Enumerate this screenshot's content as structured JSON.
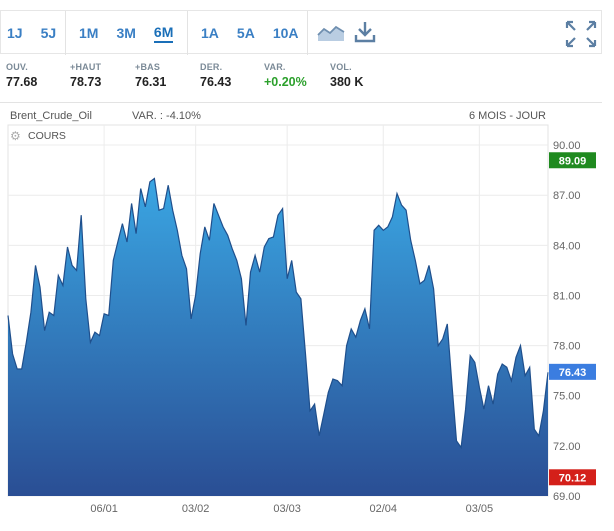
{
  "toolbar": {
    "periods_short": [
      "1J",
      "5J"
    ],
    "periods_mid": [
      "1M",
      "3M",
      "6M"
    ],
    "periods_long": [
      "1A",
      "5A",
      "10A"
    ],
    "active_period": "6M",
    "icons": [
      "line-chart-icon",
      "download-icon",
      "fullscreen-icon"
    ]
  },
  "stats": [
    {
      "label": "OUV.",
      "value": "77.68"
    },
    {
      "label": "+HAUT",
      "value": "78.73"
    },
    {
      "label": "+BAS",
      "value": "76.31"
    },
    {
      "label": "DER.",
      "value": "76.43"
    },
    {
      "label": "VAR.",
      "value": "+0.20%",
      "status": "up"
    },
    {
      "label": "VOL.",
      "value": "380 K"
    }
  ],
  "meta": {
    "instrument": "Brent_Crude_Oil",
    "var": "VAR. : -4.10%",
    "range": "6 MOIS - JOUR"
  },
  "legend": {
    "label": "COURS"
  },
  "colors": {
    "accent": "#1a6fb8",
    "area_top": "#3aa6e3",
    "area_bottom": "#2a4e94",
    "line": "#1f4f8c",
    "high_badge": "#1f8a1f",
    "last_badge": "#3b7de0",
    "low_badge": "#d4201a"
  },
  "chart_data": {
    "type": "area",
    "y_ticks": [
      "90.00",
      "87.00",
      "84.00",
      "81.00",
      "78.00",
      "75.00",
      "72.00",
      "69.00"
    ],
    "ylim": [
      69,
      91.2
    ],
    "x_ticks": [
      {
        "label": "06/01",
        "index": 21
      },
      {
        "label": "03/02",
        "index": 41
      },
      {
        "label": "03/03",
        "index": 61
      },
      {
        "label": "02/04",
        "index": 82
      },
      {
        "label": "03/05",
        "index": 103
      }
    ],
    "badges": {
      "high": "89.09",
      "last": "76.43",
      "low": "70.12"
    },
    "values": [
      79.8,
      77.5,
      76.6,
      76.6,
      78.2,
      80.0,
      82.8,
      81.5,
      78.9,
      80.0,
      79.8,
      82.2,
      81.6,
      83.9,
      82.8,
      82.5,
      85.8,
      80.8,
      78.2,
      78.8,
      78.6,
      79.9,
      79.8,
      83.1,
      84.2,
      85.3,
      84.2,
      86.5,
      84.7,
      87.4,
      86.3,
      87.8,
      88.0,
      86.1,
      86.2,
      87.6,
      86.1,
      84.9,
      83.4,
      82.6,
      79.6,
      81.0,
      83.5,
      85.1,
      84.3,
      86.5,
      85.8,
      85.1,
      84.6,
      83.8,
      83.1,
      82.0,
      79.2,
      82.4,
      83.4,
      82.4,
      83.9,
      84.4,
      84.5,
      85.8,
      86.2,
      82.0,
      83.1,
      81.2,
      80.8,
      77.5,
      74.1,
      74.5,
      72.6,
      73.9,
      75.2,
      76.0,
      75.9,
      75.6,
      78.0,
      79.0,
      78.5,
      79.5,
      80.2,
      79.0,
      84.9,
      85.2,
      84.9,
      85.1,
      85.7,
      87.1,
      86.4,
      86.1,
      84.3,
      83.1,
      81.7,
      81.9,
      82.8,
      81.4,
      78.0,
      78.4,
      79.3,
      75.7,
      72.3,
      71.9,
      74.2,
      77.4,
      77.0,
      75.5,
      74.2,
      75.6,
      74.5,
      76.3,
      76.9,
      76.7,
      75.9,
      77.3,
      78.0,
      76.2,
      76.7,
      73.0,
      72.6,
      74.1,
      76.4
    ]
  }
}
